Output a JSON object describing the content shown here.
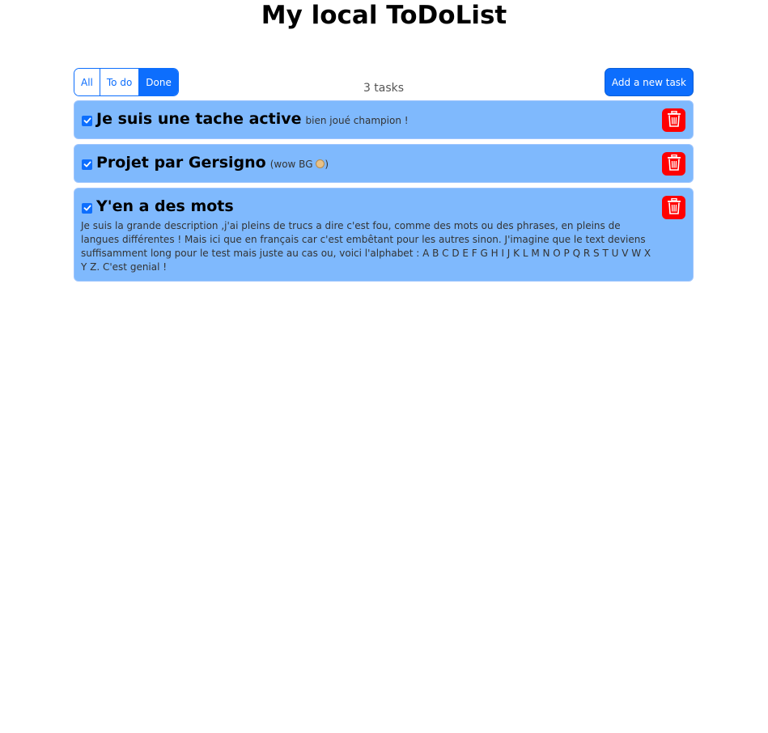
{
  "app": {
    "title": "My local ToDoList"
  },
  "toolbar": {
    "filters": [
      {
        "label": "All",
        "active": false
      },
      {
        "label": "To do",
        "active": false
      },
      {
        "label": "Done",
        "active": true
      }
    ],
    "task_count": "3 tasks",
    "add_label": "Add a new task"
  },
  "tasks": [
    {
      "title": "Je suis une tache active",
      "description": "bien joué champion !",
      "done": true
    },
    {
      "title": "Projet par Gersigno",
      "description_prefix": "(wow BG ",
      "description_emoji": "grimacing-face",
      "description_suffix": ")",
      "done": true
    },
    {
      "title": "Y'en a des mots",
      "description": "Je suis la grande description ,j'ai pleins de trucs a dire c'est fou, comme des mots ou des phrases, en pleins de langues différentes ! Mais ici que en français car c'est embêtant pour les autres sinon. J'imagine que le text deviens suffisamment long pour le test mais juste au cas ou, voici l'alphabet : A B C D E F G H I J K L M N O P Q R S T U V W X Y Z. C'est genial !",
      "done": true
    }
  ],
  "colors": {
    "primary": "#0d6efd",
    "task_bg": "#7fb9fd",
    "delete": "#ff0000"
  },
  "icons": {
    "checkbox": "checked-checkbox-icon",
    "delete": "trash-icon"
  }
}
